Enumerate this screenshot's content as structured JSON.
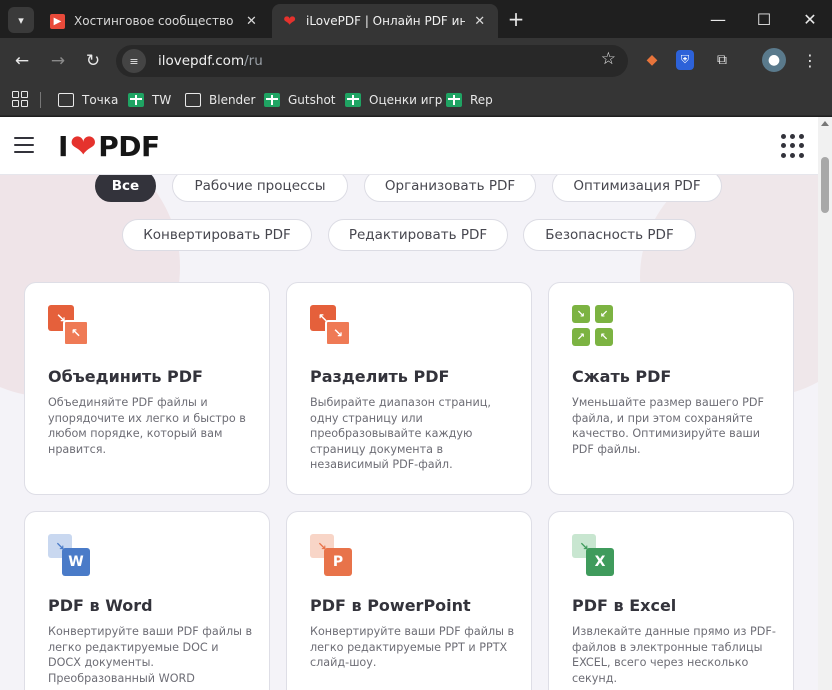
{
  "browser": {
    "tabs": [
      {
        "title": "Хостинговое сообщество «Tim",
        "favicon": "timeweb-icon",
        "active": false
      },
      {
        "title": "iLovePDF | Онлайн PDF инстру",
        "favicon": "ilovepdf-heart-icon",
        "active": true
      }
    ],
    "address": {
      "host": "ilovepdf.com",
      "path": "/ru"
    },
    "bookmarks": [
      {
        "label": "Точка",
        "icon": "folder-icon"
      },
      {
        "label": "TW",
        "icon": "sheets-icon"
      },
      {
        "label": "Blender",
        "icon": "folder-icon"
      },
      {
        "label": "Gutshot",
        "icon": "sheets-icon"
      },
      {
        "label": "Оценки игр",
        "icon": "sheets-icon"
      },
      {
        "label": "Rep",
        "icon": "sheets-icon"
      }
    ]
  },
  "site": {
    "logo": {
      "pre": "I",
      "post": "PDF"
    },
    "filters": [
      {
        "label": "Все",
        "active": true
      },
      {
        "label": "Рабочие процессы",
        "active": false
      },
      {
        "label": "Организовать PDF",
        "active": false
      },
      {
        "label": "Оптимизация PDF",
        "active": false
      },
      {
        "label": "Конвертировать PDF",
        "active": false
      },
      {
        "label": "Редактировать PDF",
        "active": false
      },
      {
        "label": "Безопасность PDF",
        "active": false
      }
    ],
    "tools": [
      {
        "title": "Объединить PDF",
        "desc": "Объединяйте PDF файлы и упорядочите их легко и быстро в любом порядке, который вам нравится.",
        "icon": "merge-pdf-icon",
        "color": "#e5603b"
      },
      {
        "title": "Разделить PDF",
        "desc": "Выбирайте диапазон страниц, одну страницу или преобразовывайте каждую страницу документа в независимый PDF-файл.",
        "icon": "split-pdf-icon",
        "color": "#e5603b"
      },
      {
        "title": "Сжать PDF",
        "desc": "Уменьшайте размер вашего PDF файла, и при этом сохраняйте качество. Оптимизируйте ваши PDF файлы.",
        "icon": "compress-pdf-icon",
        "color": "#7cb342"
      },
      {
        "title": "PDF в Word",
        "desc": "Конвертируйте ваши PDF файлы в легко редактируемые DOC и DOCX документы. Преобразованный WORD",
        "icon": "pdf-to-word-icon",
        "color": "#4a7bc8",
        "badge": "W"
      },
      {
        "title": "PDF в PowerPoint",
        "desc": "Конвертируйте ваши PDF файлы в легко редактируемые PPT и PPTX слайд-шоу.",
        "icon": "pdf-to-powerpoint-icon",
        "color": "#e8734a",
        "badge": "P"
      },
      {
        "title": "PDF в Excel",
        "desc": "Извлекайте данные прямо из PDF-файлов в электронные таблицы EXCEL, всего через несколько секунд.",
        "icon": "pdf-to-excel-icon",
        "color": "#3f9b5c",
        "badge": "X"
      }
    ]
  }
}
